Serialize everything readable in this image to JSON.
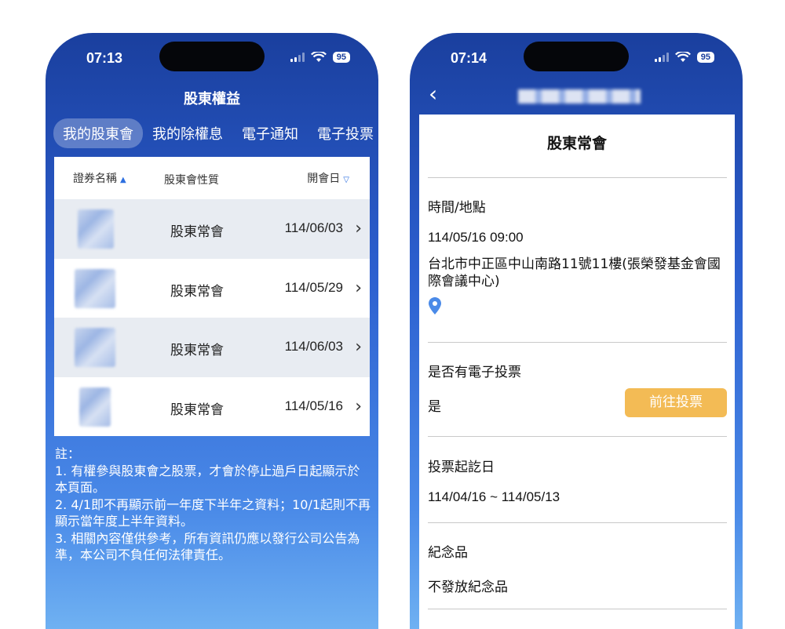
{
  "left": {
    "time": "07:13",
    "battery": "95",
    "title": "股東權益",
    "tabs": [
      "我的股東會",
      "我的除權息",
      "電子通知",
      "電子投票"
    ],
    "columns": [
      "證券名稱",
      "股東會性質",
      "開會日"
    ],
    "rows": [
      {
        "type": "股東常會",
        "date": "114/06/03"
      },
      {
        "type": "股東常會",
        "date": "114/05/29"
      },
      {
        "type": "股東常會",
        "date": "114/06/03"
      },
      {
        "type": "股東常會",
        "date": "114/05/16"
      }
    ],
    "notes": [
      "註：",
      "1. 有權參與股東會之股票，才會於停止過戶日起顯示於本頁面。",
      "2. 4/1即不再顯示前一年度下半年之資料；10/1起則不再顯示當年度上半年資料。",
      "3. 相關內容僅供參考，所有資訊仍應以發行公司公告為準，本公司不負任何法律責任。"
    ]
  },
  "right": {
    "time": "07:14",
    "battery": "95",
    "card_title": "股東常會",
    "time_place_label": "時間/地點",
    "datetime": "114/05/16 09:00",
    "address": "台北市中正區中山南路11號11樓(張榮發基金會國際會議中心)",
    "evote_label": "是否有電子投票",
    "evote_value": "是",
    "vote_button": "前往投票",
    "vote_period_label": "投票起訖日",
    "vote_period": "114/04/16 ~ 114/05/13",
    "gift_label": "紀念品",
    "gift_value": "不發放紀念品"
  },
  "colors": {
    "accent": "#2d6fe0",
    "button": "#f3bb55",
    "row_shade": "#e8ecf2"
  }
}
